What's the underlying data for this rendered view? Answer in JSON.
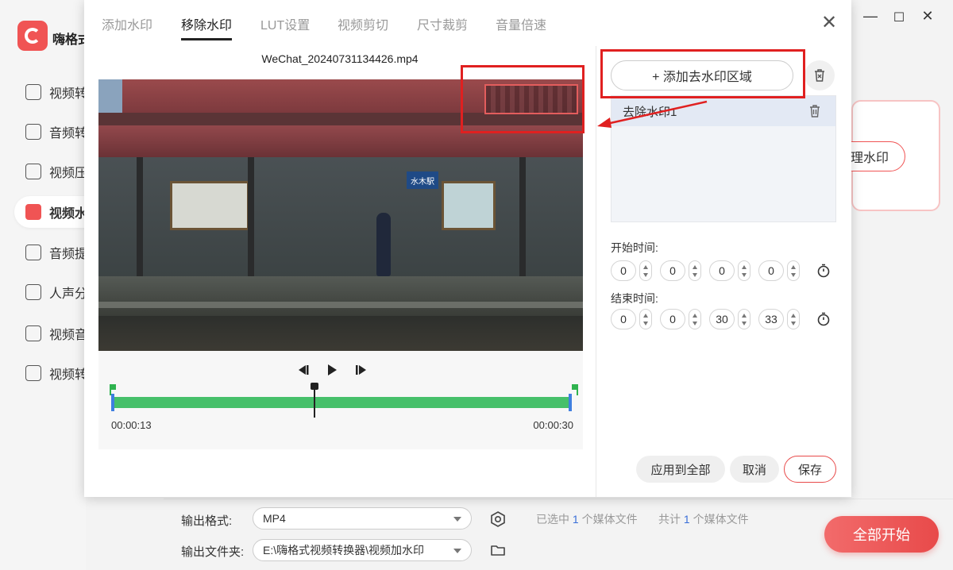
{
  "app": {
    "name": "嗨格式",
    "sidebar": [
      {
        "label": "视频转换"
      },
      {
        "label": "音频转换"
      },
      {
        "label": "视频压缩"
      },
      {
        "label": "视频水印"
      },
      {
        "label": "音频提取"
      },
      {
        "label": "人声分离"
      },
      {
        "label": "视频音量"
      },
      {
        "label": "视频转GIF"
      }
    ],
    "bg_button": "理水印"
  },
  "dialog": {
    "tabs": [
      "添加水印",
      "移除水印",
      "LUT设置",
      "视频剪切",
      "尺寸裁剪",
      "音量倍速"
    ],
    "active_tab": "移除水印",
    "filename": "WeChat_20240731134426.mp4",
    "video_sign": "水木駅",
    "player": {
      "time_start": "00:00:13",
      "time_end": "00:00:30",
      "playhead_fraction": 0.44
    },
    "add_region_label": "+ 添加去水印区域",
    "regions": [
      {
        "label": "去除水印1"
      }
    ],
    "start_time_label": "开始时间:",
    "end_time_label": "结束时间:",
    "start_time": [
      "0",
      "0",
      "0",
      "0"
    ],
    "end_time": [
      "0",
      "0",
      "30",
      "33"
    ],
    "apply_all": "应用到全部",
    "cancel": "取消",
    "save": "保存"
  },
  "bottom": {
    "format_label": "输出格式:",
    "format_value": "MP4",
    "folder_label": "输出文件夹:",
    "folder_value": "E:\\嗨格式视频转换器\\视频加水印",
    "selected_prefix": "已选中",
    "selected_count": "1",
    "selected_suffix": "个媒体文件",
    "total_prefix": "共计",
    "total_count": "1",
    "total_suffix": "个媒体文件",
    "start_all": "全部开始"
  },
  "colors": {
    "accent": "#e84a4a",
    "track": "#46c06a",
    "annotation": "#e02020"
  }
}
